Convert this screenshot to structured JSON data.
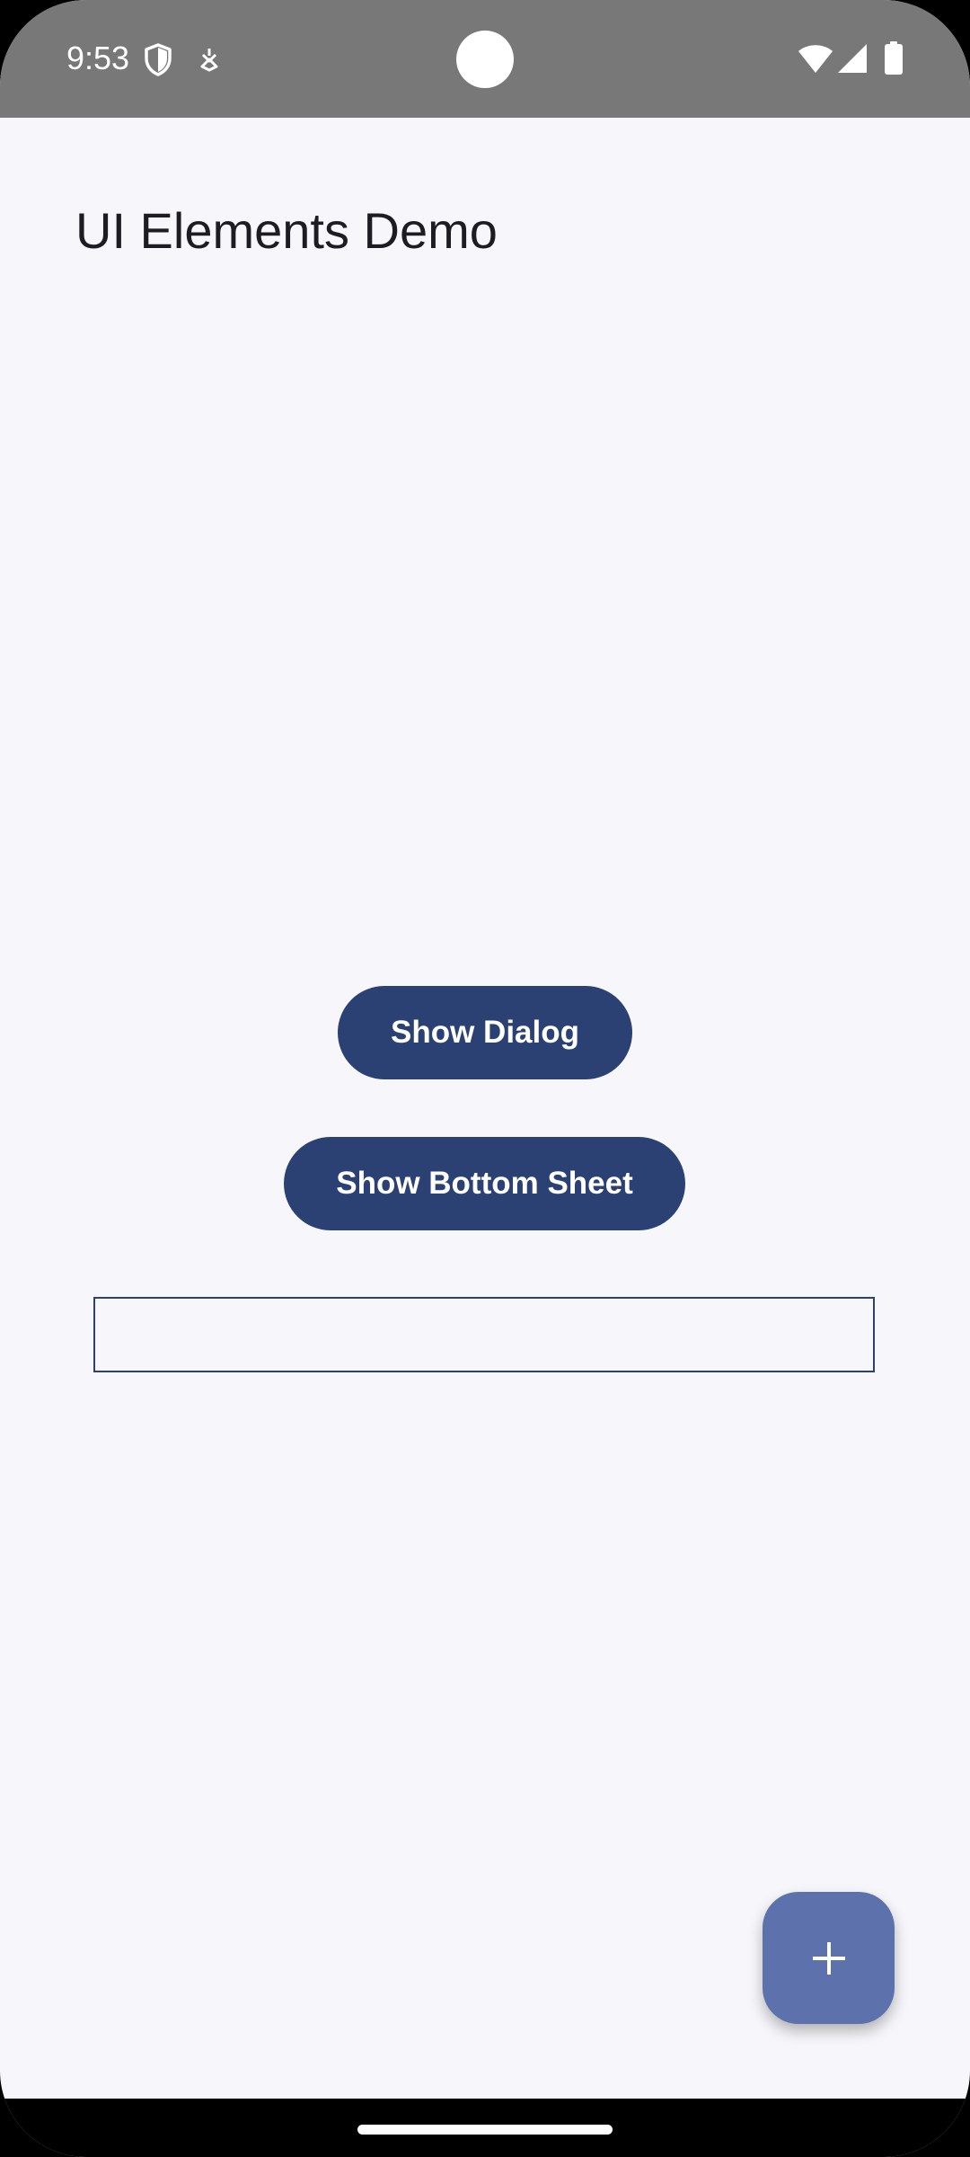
{
  "status_bar": {
    "time": "9:53",
    "left_icons": [
      "shield-icon",
      "download-icon"
    ],
    "right_icons": [
      "wifi-icon",
      "signal-icon",
      "battery-icon"
    ]
  },
  "app": {
    "title": "UI Elements Demo"
  },
  "buttons": {
    "show_dialog_label": "Show Dialog",
    "show_bottom_sheet_label": "Show Bottom Sheet"
  },
  "text_field": {
    "value": "",
    "placeholder": ""
  },
  "fab": {
    "icon": "plus-icon"
  },
  "colors": {
    "status_bar": "#787878",
    "background": "#f7f7fb",
    "button": "#2b4174",
    "fab": "#5d72ad"
  }
}
